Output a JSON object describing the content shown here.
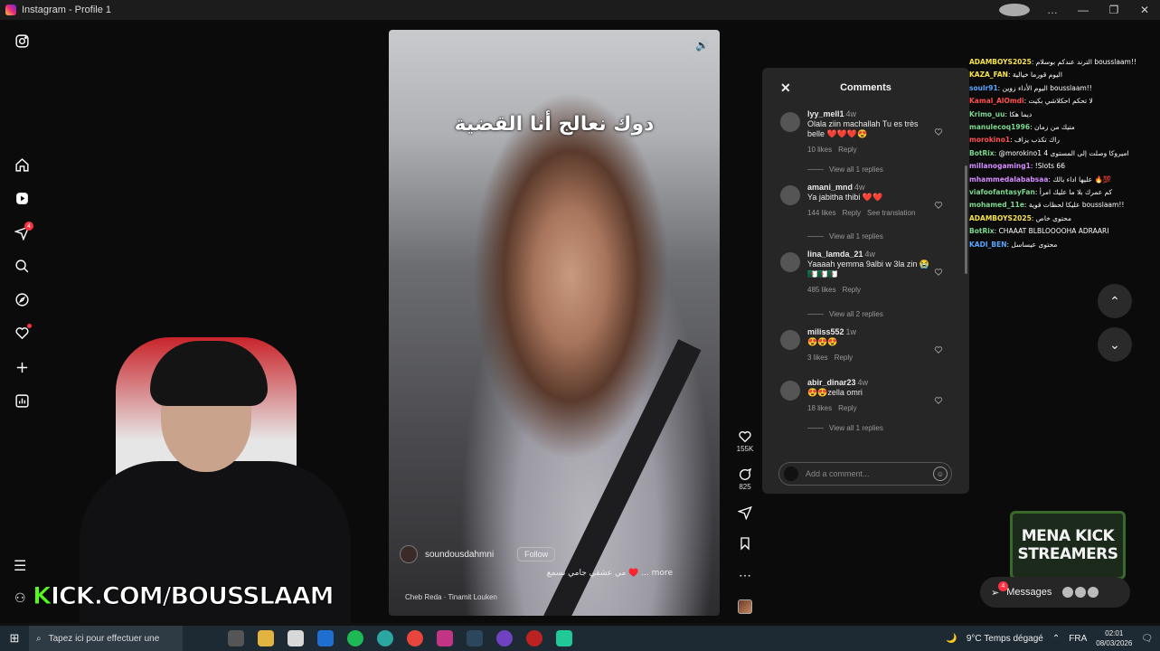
{
  "window": {
    "title": "Instagram - Profile 1",
    "controls": [
      "…",
      "—",
      "❐",
      "✕"
    ]
  },
  "reel": {
    "caption_overlay": "دوك نعالج أنا القضية",
    "author": "soundousdahmni",
    "follow_label": "Follow",
    "description": "مي عشقي جامي نسمع ♥️ ... more",
    "music": "Cheb Reda · Tinamit Louken"
  },
  "actions": {
    "likes": "155K",
    "comments": "825"
  },
  "comments_panel": {
    "title": "Comments",
    "items": [
      {
        "user": "lyy_mell1",
        "time": "4w",
        "text": "Olala ziin machallah Tu es très belle ❤️❤️❤️😍",
        "likes": "10 likes",
        "reply": "Reply",
        "translation": "",
        "view": "View all 1 replies"
      },
      {
        "user": "amani_mnd",
        "time": "4w",
        "text": "Ya jabitha thibi ❤️❤️",
        "likes": "144 likes",
        "reply": "Reply",
        "translation": "See translation",
        "view": "View all 1 replies"
      },
      {
        "user": "lina_lamda_21",
        "time": "4w",
        "text": "Yaaaah yemma 9albi w 3la zin 😭 🇩🇿🇩🇿🇩🇿",
        "likes": "485 likes",
        "reply": "Reply",
        "translation": "",
        "view": "View all 2 replies"
      },
      {
        "user": "miliss552",
        "time": "1w",
        "text": "😍😍😍",
        "likes": "3 likes",
        "reply": "Reply",
        "translation": "",
        "view": ""
      },
      {
        "user": "abir_dinar23",
        "time": "4w",
        "text": "😍😍zella omri",
        "likes": "18 likes",
        "reply": "Reply",
        "translation": "",
        "view": "View all 1 replies"
      }
    ],
    "add_placeholder": "Add a comment..."
  },
  "chat": [
    {
      "user": "ADAMBOYS2025",
      "color": "#f6e24a",
      "msg": "الترند عندكم بوسلام bousslaam!!"
    },
    {
      "user": "KAZA_FAN",
      "color": "#f6e24a",
      "msg": "اليوم قورما خيالية"
    },
    {
      "user": "soulr91",
      "color": "#58a6ff",
      "msg": "اليوم الأداء زوين bousslaam!!"
    },
    {
      "user": "Kamal_AlOmdi",
      "color": "#ff4f4f",
      "msg": "لا تحكم احكلاشي بكيت"
    },
    {
      "user": "Krimo_uu",
      "color": "#7bd88f",
      "msg": "ديما هكا"
    },
    {
      "user": "manulecoq1996",
      "color": "#7bd88f",
      "msg": "متيك من زمان"
    },
    {
      "user": "morokino1",
      "color": "#ff4f4f",
      "msg": "راك تكذب يزاف"
    },
    {
      "user": "BotRix",
      "color": "#7bd88f",
      "msg": "@morokino1 اميروكا وصلت إلى المستوى 4"
    },
    {
      "user": "millanogaming1",
      "color": "#d58bff",
      "msg": "!Slots 66"
    },
    {
      "user": "mhammedalababsaa",
      "color": "#d58bff",
      "msg": "عليها اداء بالك 🔥💯"
    },
    {
      "user": "viafoofantasyFan",
      "color": "#7bd88f",
      "msg": "كم عمرك بلا ما عليك امرأ"
    },
    {
      "user": "mohamed_11e",
      "color": "#7bd88f",
      "msg": "عليكا لحظات قوية bousslaam!!"
    },
    {
      "user": "ADAMBOYS2025",
      "color": "#f6e24a",
      "msg": "محتوى خاص"
    },
    {
      "user": "BotRix",
      "color": "#7bd88f",
      "msg": "CHAAAT BLBLOOOOHA ADRAARI"
    },
    {
      "user": "KADI_BEN",
      "color": "#58a6ff",
      "msg": "محتوى عيساسل"
    }
  ],
  "nav": {
    "up": "⌃",
    "down": "⌄"
  },
  "overlay": {
    "kick_k": "K",
    "kick_rest": "ICK.COM/BOUSSLAAM",
    "logo_line1": "MENA KICK",
    "logo_line2": "STREAMERS"
  },
  "messages": {
    "label": "Messages",
    "badge": "4"
  },
  "rail": {
    "notif_badge": "4"
  },
  "taskbar": {
    "search_placeholder": "Tapez ici pour effectuer une",
    "weather": "9°C  Temps dégagé",
    "lang": "FRA",
    "time": "02:01",
    "date": "08/03/2026"
  },
  "colors": {
    "accent_kick": "#53fc18",
    "notif": "#ff3040",
    "panel": "#262626"
  }
}
